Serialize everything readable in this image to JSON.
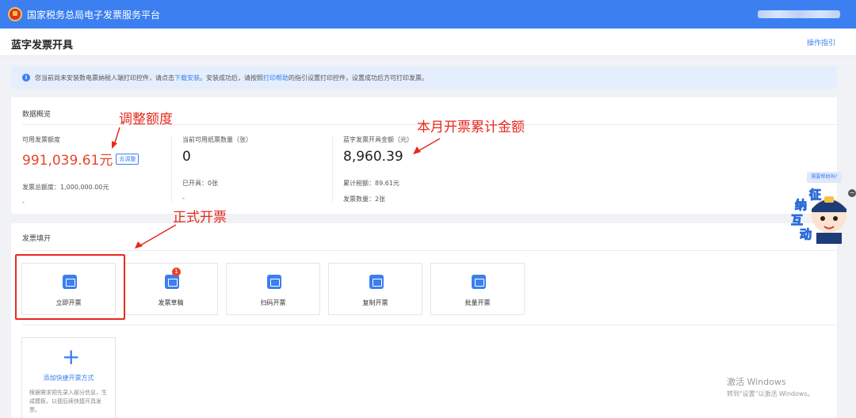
{
  "header": {
    "app_title": "国家税务总局电子发票服务平台",
    "logo_icon": "tax-emblem-icon",
    "brand_color": "#3b7ff0"
  },
  "page": {
    "title": "蓝字发票开具",
    "guide_link": "操作指引"
  },
  "notice": {
    "icon": "info-icon",
    "text_1": "您当前尚未安装数电票纳税人端打印控件，请点击",
    "download_link": "下载安装",
    "text_2": "。安装成功后，请按照",
    "help_link": "打印帮助",
    "text_3": "的指引设置打印控件，设置成功后方可打印发票。"
  },
  "overview": {
    "title": "数据概览",
    "available_quota": {
      "label": "可用发票额度",
      "value": "991,039.61元",
      "adjust_button": "去调整",
      "sub_label": "发票总额度：",
      "sub_value": "1,000,000.00元",
      "sub2": "-"
    },
    "paper_count": {
      "label": "当前可用纸票数量（张）",
      "value": "0",
      "sub_label": "已开具：",
      "sub_value": "0张",
      "sub2": "-"
    },
    "blue_amount": {
      "label": "蓝字发票开具金额（元）",
      "value": "8,960.39",
      "tax_label": "累计税额：",
      "tax_value": "89.61元",
      "count_label": "发票数量：",
      "count_value": "2张"
    }
  },
  "invoice_fill": {
    "title": "发票填开",
    "tiles": [
      {
        "label": "立即开票",
        "icon": "invoice-ticket-icon"
      },
      {
        "label": "发票草稿",
        "icon": "draft-inbox-icon",
        "badge": "1"
      },
      {
        "label": "扫码开票",
        "icon": "qr-scan-icon"
      },
      {
        "label": "复制开票",
        "icon": "copy-invoice-icon"
      },
      {
        "label": "批量开票",
        "icon": "batch-invoice-icon"
      }
    ],
    "add_shortcut": {
      "icon": "plus-icon",
      "label": "添加快捷开票方式",
      "desc": "根据需求预先录入部分信息，生成模板，以便后续快捷开具发票。"
    }
  },
  "annotations": {
    "adjust_quota": "调整额度",
    "monthly_total": "本月开票累计金额",
    "formal_invoice": "正式开票",
    "color": "#e8291c"
  },
  "floating": {
    "help_tag": "需要帮助吗?",
    "mascot_text": [
      "征",
      "纳",
      "互",
      "动"
    ]
  },
  "watermark": {
    "line1": "激活 Windows",
    "line2": "转到\"设置\"以激活 Windows。"
  }
}
